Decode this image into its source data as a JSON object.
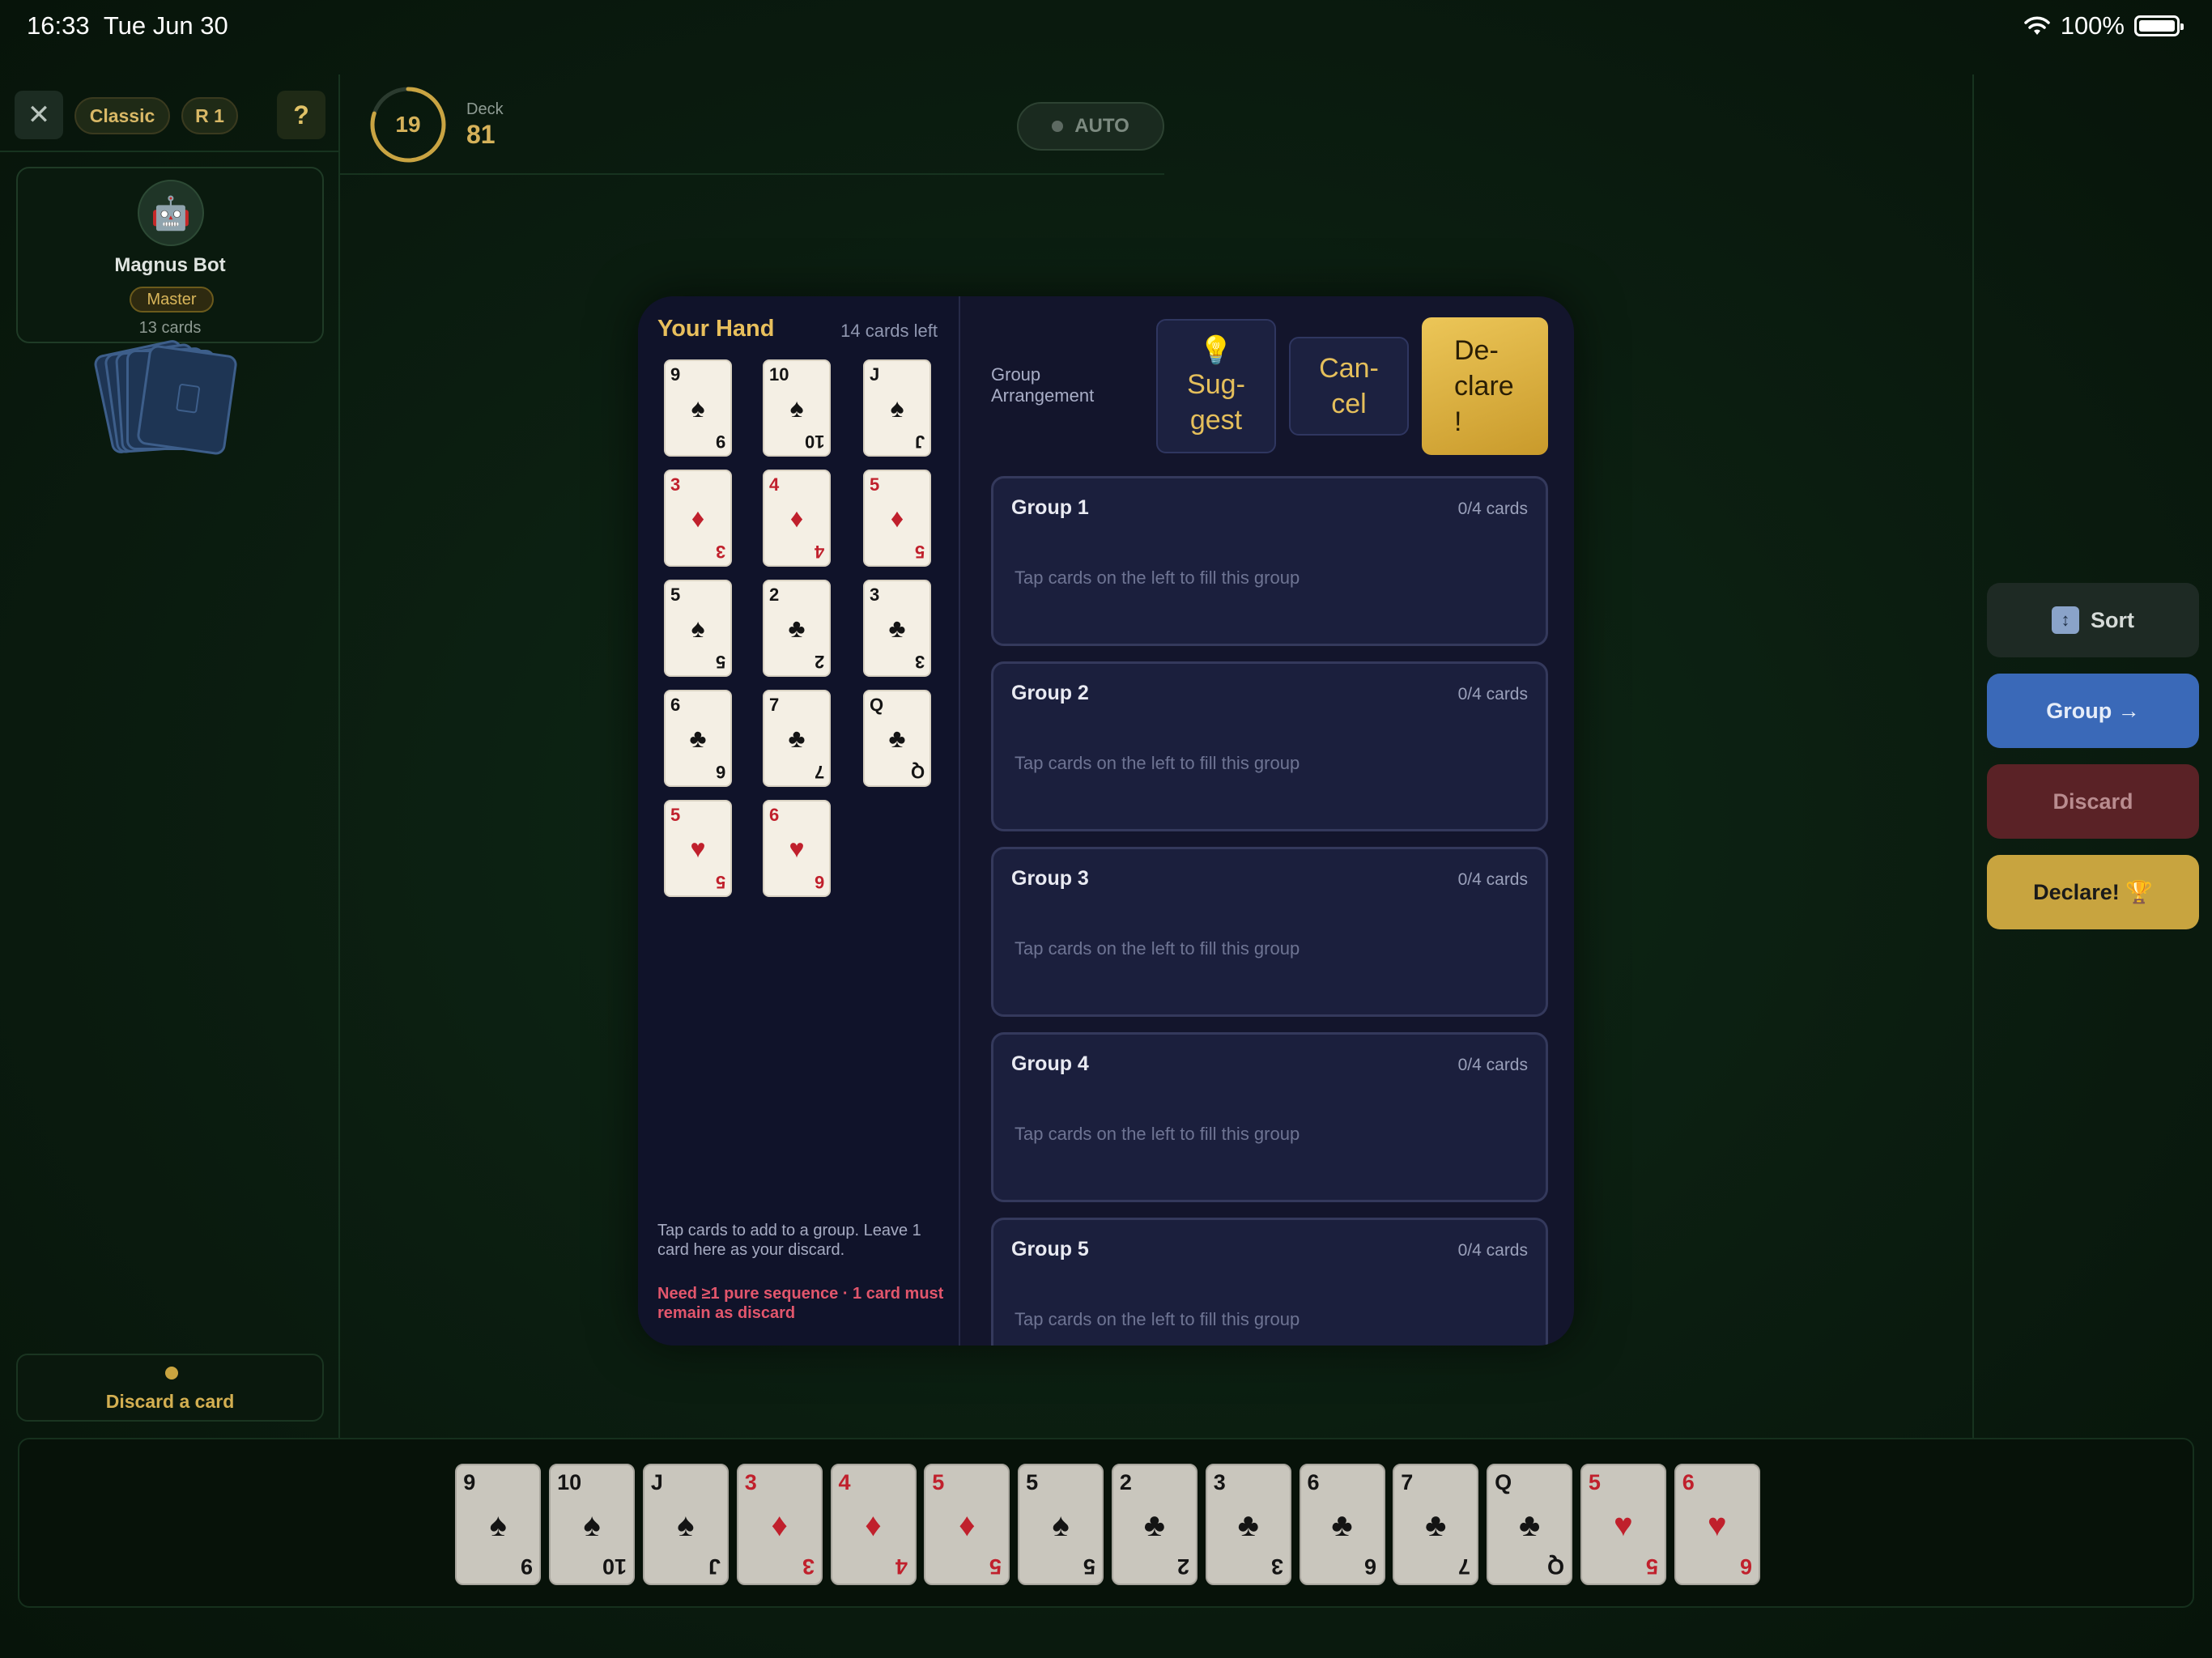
{
  "status": {
    "time": "16:33",
    "date": "Tue Jun 30",
    "battery": "100%"
  },
  "top_controls": {
    "close_icon": "✕",
    "mode": "Classic",
    "round": "R 1",
    "help": "?"
  },
  "opponent": {
    "avatar": "🤖",
    "name": "Magnus Bot",
    "rank": "Master",
    "cards": "13 cards"
  },
  "discard_hint": "Discard a card",
  "timer": {
    "value": "19",
    "progress": 0.8
  },
  "deck": {
    "label": "Deck",
    "count": "81"
  },
  "auto": {
    "label": "AUTO"
  },
  "actions": {
    "sort": "Sort",
    "sort_icon": "↕",
    "group": "Group →",
    "discard": "Discard",
    "declare": "Declare! 🏆"
  },
  "modal": {
    "title": "Your Hand",
    "cards_left": "14 cards left",
    "hand": [
      {
        "rank": "9",
        "suit": "♠",
        "color": "black"
      },
      {
        "rank": "10",
        "suit": "♠",
        "color": "black"
      },
      {
        "rank": "J",
        "suit": "♠",
        "color": "black"
      },
      {
        "rank": "3",
        "suit": "♦",
        "color": "red"
      },
      {
        "rank": "4",
        "suit": "♦",
        "color": "red"
      },
      {
        "rank": "5",
        "suit": "♦",
        "color": "red"
      },
      {
        "rank": "5",
        "suit": "♠",
        "color": "black"
      },
      {
        "rank": "2",
        "suit": "♣",
        "color": "black"
      },
      {
        "rank": "3",
        "suit": "♣",
        "color": "black"
      },
      {
        "rank": "6",
        "suit": "♣",
        "color": "black"
      },
      {
        "rank": "7",
        "suit": "♣",
        "color": "black"
      },
      {
        "rank": "Q",
        "suit": "♣",
        "color": "black"
      },
      {
        "rank": "5",
        "suit": "♥",
        "color": "red"
      },
      {
        "rank": "6",
        "suit": "♥",
        "color": "red"
      }
    ],
    "hint": "Tap cards to add to a group. Leave 1 card here as your discard.",
    "warning": "Need ≥1 pure sequence · 1 card must remain as discard",
    "arrangement_label": "Group Arrangement",
    "suggest_icon": "💡",
    "suggest": "Sug-\ngest",
    "cancel": "Can-\ncel",
    "declare": "De-\nclare\n!",
    "groups": [
      {
        "title": "Group 1",
        "count": "0/4 cards",
        "placeholder": "Tap cards on the left to fill this group"
      },
      {
        "title": "Group 2",
        "count": "0/4 cards",
        "placeholder": "Tap cards on the left to fill this group"
      },
      {
        "title": "Group 3",
        "count": "0/4 cards",
        "placeholder": "Tap cards on the left to fill this group"
      },
      {
        "title": "Group 4",
        "count": "0/4 cards",
        "placeholder": "Tap cards on the left to fill this group"
      },
      {
        "title": "Group 5",
        "count": "0/4 cards",
        "placeholder": "Tap cards on the left to fill this group"
      }
    ]
  },
  "bottom_hand": [
    {
      "rank": "9",
      "suit": "♠",
      "color": "black"
    },
    {
      "rank": "10",
      "suit": "♠",
      "color": "black"
    },
    {
      "rank": "J",
      "suit": "♠",
      "color": "black"
    },
    {
      "rank": "3",
      "suit": "♦",
      "color": "red"
    },
    {
      "rank": "4",
      "suit": "♦",
      "color": "red"
    },
    {
      "rank": "5",
      "suit": "♦",
      "color": "red"
    },
    {
      "rank": "5",
      "suit": "♠",
      "color": "black"
    },
    {
      "rank": "2",
      "suit": "♣",
      "color": "black"
    },
    {
      "rank": "3",
      "suit": "♣",
      "color": "black"
    },
    {
      "rank": "6",
      "suit": "♣",
      "color": "black"
    },
    {
      "rank": "7",
      "suit": "♣",
      "color": "black"
    },
    {
      "rank": "Q",
      "suit": "♣",
      "color": "black"
    },
    {
      "rank": "5",
      "suit": "♥",
      "color": "red"
    },
    {
      "rank": "6",
      "suit": "♥",
      "color": "red"
    }
  ],
  "colors": {
    "accent_gold": "#d6b25a",
    "card_red": "#c0202c",
    "group_blue": "#3a69b8",
    "discard_red": "#5a2226"
  }
}
